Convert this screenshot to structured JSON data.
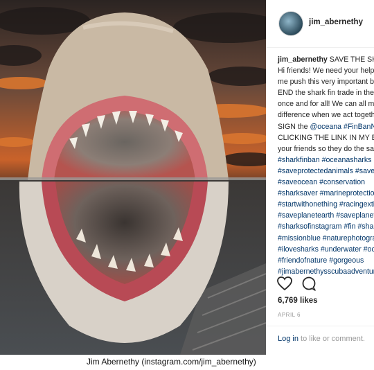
{
  "post": {
    "username": "jim_abernethy",
    "caption_lines": [
      {
        "parts": [
          {
            "t": "jim_abernethy",
            "k": "b"
          },
          {
            "t": " SAVE THE SHARKS!",
            "k": "n"
          }
        ]
      },
      {
        "parts": [
          {
            "t": "Hi friends! We need your help to",
            "k": "n"
          }
        ]
      },
      {
        "parts": [
          {
            "t": "me push this very important bill to",
            "k": "n"
          }
        ]
      },
      {
        "parts": [
          {
            "t": "END the shark fin trade in the USA",
            "k": "n"
          }
        ]
      },
      {
        "parts": [
          {
            "t": "once and for all! We can all make a",
            "k": "n"
          }
        ]
      },
      {
        "parts": [
          {
            "t": "difference when we act together!",
            "k": "n"
          }
        ]
      },
      {
        "parts": [
          {
            "t": "SIGN the ",
            "k": "n"
          },
          {
            "t": "@oceana",
            "k": "tag"
          },
          {
            "t": " ",
            "k": "n"
          },
          {
            "t": "#FinBanNow",
            "k": "tag"
          }
        ]
      },
      {
        "parts": [
          {
            "t": "CLICKING THE LINK IN MY BIO & tell",
            "k": "n"
          }
        ]
      },
      {
        "parts": [
          {
            "t": "your friends so they do the same!",
            "k": "n"
          }
        ]
      },
      {
        "parts": [
          {
            "t": "#sharkfinban #oceanasharks",
            "k": "tag"
          }
        ]
      },
      {
        "parts": [
          {
            "t": "#saveprotectedanimals #savesharks",
            "k": "tag"
          }
        ]
      },
      {
        "parts": [
          {
            "t": "#saveocean #conservation",
            "k": "tag"
          }
        ]
      },
      {
        "parts": [
          {
            "t": "#sharksaver #marineprotection",
            "k": "tag"
          }
        ]
      },
      {
        "parts": [
          {
            "t": "#startwithonething #racingextinction",
            "k": "tag"
          }
        ]
      },
      {
        "parts": [
          {
            "t": "#saveplanetearth #saveplanet",
            "k": "tag"
          }
        ]
      },
      {
        "parts": [
          {
            "t": "#sharksofinstagram #fin #shark",
            "k": "tag"
          }
        ]
      },
      {
        "parts": [
          {
            "t": "#missionblue #naturephotography",
            "k": "tag"
          }
        ]
      },
      {
        "parts": [
          {
            "t": "#ilovesharks #underwater #ocean",
            "k": "tag"
          }
        ]
      },
      {
        "parts": [
          {
            "t": "#friendofnature #gorgeous",
            "k": "tag"
          }
        ]
      },
      {
        "parts": [
          {
            "t": "#jimabernethysscubaadventures",
            "k": "tag"
          }
        ]
      }
    ],
    "likes": "6,769 likes",
    "date": "APRIL 6",
    "comment_login": "Log in",
    "comment_rest": " to like or comment.",
    "photo_alt": "",
    "icons": {
      "like": "heart-icon",
      "comment": "comment-bubble-icon"
    }
  },
  "credit": "Jim Abernethy (instagram.com/jim_abernethy)"
}
